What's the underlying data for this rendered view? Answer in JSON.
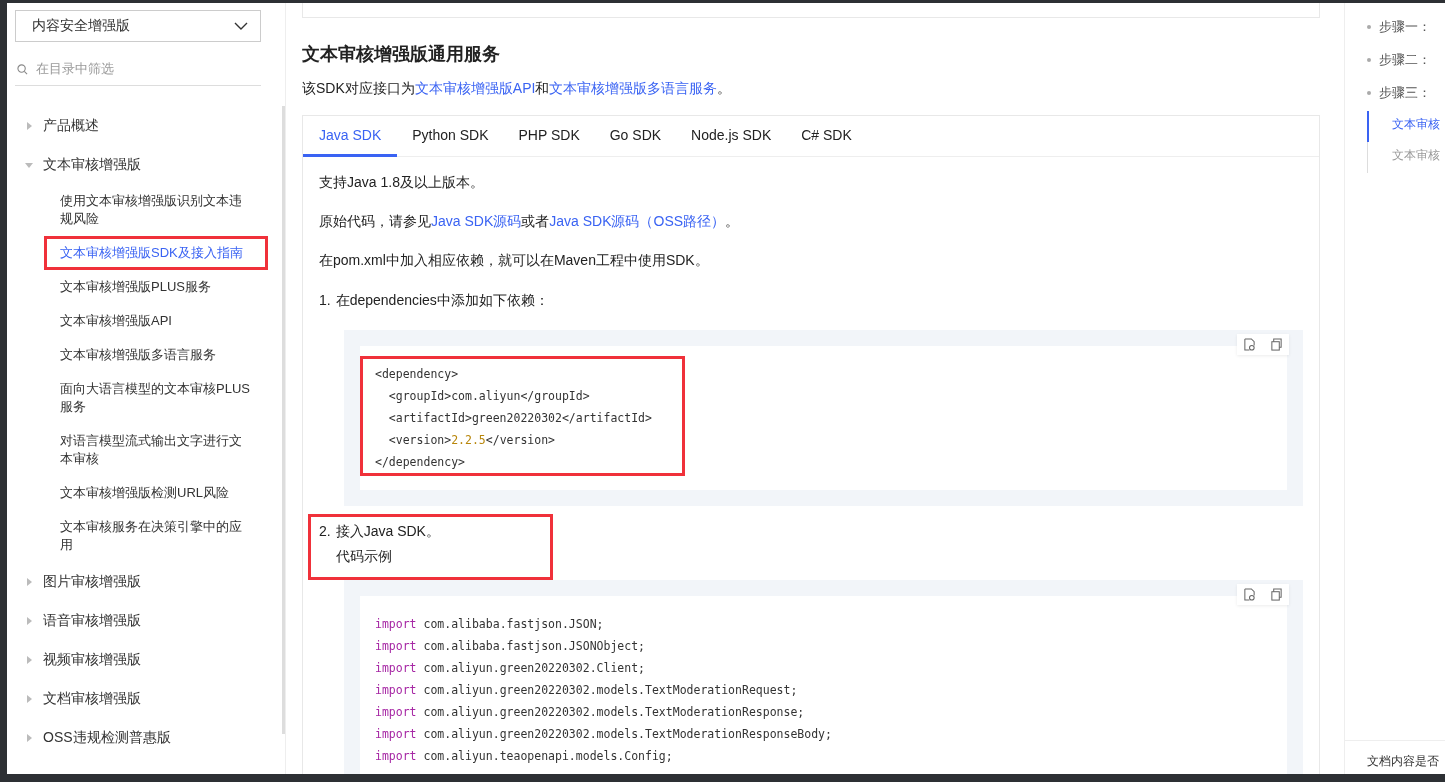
{
  "sidebar": {
    "product_select": "内容安全增强版",
    "filter": {
      "placeholder": "在目录中筛选"
    },
    "tree": [
      {
        "label": "产品概述",
        "expanded": false
      },
      {
        "label": "文本审核增强版",
        "expanded": true,
        "children": [
          {
            "label": "使用文本审核增强版识别文本违规风险",
            "selected": false,
            "highlighted": false
          },
          {
            "label": "文本审核增强版SDK及接入指南",
            "selected": true,
            "highlighted": true
          },
          {
            "label": "文本审核增强版PLUS服务",
            "selected": false,
            "highlighted": false
          },
          {
            "label": "文本审核增强版API",
            "selected": false,
            "highlighted": false
          },
          {
            "label": "文本审核增强版多语言服务",
            "selected": false,
            "highlighted": false
          },
          {
            "label": "面向大语言模型的文本审核PLUS服务",
            "selected": false,
            "highlighted": false
          },
          {
            "label": "对语言模型流式输出文字进行文本审核",
            "selected": false,
            "highlighted": false
          },
          {
            "label": "文本审核增强版检测URL风险",
            "selected": false,
            "highlighted": false
          },
          {
            "label": "文本审核服务在决策引擎中的应用",
            "selected": false,
            "highlighted": false
          }
        ]
      },
      {
        "label": "图片审核增强版",
        "expanded": false
      },
      {
        "label": "语音审核增强版",
        "expanded": false
      },
      {
        "label": "视频审核增强版",
        "expanded": false
      },
      {
        "label": "文档审核增强版",
        "expanded": false
      },
      {
        "label": "OSS违规检测普惠版",
        "expanded": false
      }
    ]
  },
  "main": {
    "heading": "文本审核增强版通用服务",
    "intro": [
      {
        "text": "该SDK对应接口为",
        "kind": "plain"
      },
      {
        "text": "文本审核增强版API",
        "kind": "link"
      },
      {
        "text": "和",
        "kind": "plain"
      },
      {
        "text": "文本审核增强版多语言服务",
        "kind": "link"
      },
      {
        "text": "。",
        "kind": "plain"
      }
    ],
    "tabs": [
      {
        "label": "Java SDK",
        "selected": true
      },
      {
        "label": "Python SDK",
        "selected": false
      },
      {
        "label": "PHP SDK",
        "selected": false
      },
      {
        "label": "Go SDK",
        "selected": false
      },
      {
        "label": "Node.js SDK",
        "selected": false
      },
      {
        "label": "C# SDK",
        "selected": false
      }
    ],
    "paragraphs": [
      [
        {
          "text": "支持Java 1.8及以上版本。",
          "kind": "plain"
        }
      ],
      [
        {
          "text": "原始代码，请参见",
          "kind": "plain"
        },
        {
          "text": "Java SDK源码",
          "kind": "link"
        },
        {
          "text": "或者",
          "kind": "plain"
        },
        {
          "text": "Java SDK源码（OSS路径）",
          "kind": "link"
        },
        {
          "text": "。",
          "kind": "plain"
        }
      ],
      [
        {
          "text": "在pom.xml中加入相应依赖，就可以在Maven工程中使用SDK。",
          "kind": "plain"
        }
      ]
    ],
    "steps": [
      {
        "number": "1.",
        "lines": [
          "在dependencies中添加如下依赖："
        ],
        "highlighted": false,
        "code": {
          "highlighted": true,
          "lines": [
            [
              {
                "text": "<dependency>",
                "kind": "plain"
              }
            ],
            [
              {
                "text": "  <groupId>com.aliyun</groupId>",
                "kind": "plain"
              }
            ],
            [
              {
                "text": "  <artifactId>green20220302</artifactId>",
                "kind": "plain"
              }
            ],
            [
              {
                "text": "  <version>",
                "kind": "plain"
              },
              {
                "text": "2.2.5",
                "kind": "number"
              },
              {
                "text": "</version>",
                "kind": "plain"
              }
            ],
            [
              {
                "text": "</dependency>",
                "kind": "plain"
              }
            ]
          ]
        }
      },
      {
        "number": "2.",
        "lines": [
          "接入Java SDK。",
          "代码示例"
        ],
        "highlighted": true,
        "code": {
          "highlighted": false,
          "lines": [
            [
              {
                "text": "import",
                "kind": "keyword"
              },
              {
                "text": " com.alibaba.fastjson.JSON;",
                "kind": "plain"
              }
            ],
            [
              {
                "text": "import",
                "kind": "keyword"
              },
              {
                "text": " com.alibaba.fastjson.JSONObject;",
                "kind": "plain"
              }
            ],
            [
              {
                "text": "import",
                "kind": "keyword"
              },
              {
                "text": " com.aliyun.green20220302.Client;",
                "kind": "plain"
              }
            ],
            [
              {
                "text": "import",
                "kind": "keyword"
              },
              {
                "text": " com.aliyun.green20220302.models.TextModerationRequest;",
                "kind": "plain"
              }
            ],
            [
              {
                "text": "import",
                "kind": "keyword"
              },
              {
                "text": " com.aliyun.green20220302.models.TextModerationResponse;",
                "kind": "plain"
              }
            ],
            [
              {
                "text": "import",
                "kind": "keyword"
              },
              {
                "text": " com.aliyun.green20220302.models.TextModerationResponseBody;",
                "kind": "plain"
              }
            ],
            [
              {
                "text": "import",
                "kind": "keyword"
              },
              {
                "text": " com.aliyun.teaopenapi.models.Config;",
                "kind": "plain"
              }
            ]
          ]
        }
      }
    ]
  },
  "toc": {
    "items": [
      {
        "label": "步骤一："
      },
      {
        "label": "步骤二："
      },
      {
        "label": "步骤三："
      }
    ],
    "subitems": [
      {
        "label": "文本审核",
        "selected": true
      },
      {
        "label": "文本审核",
        "selected": false
      }
    ],
    "feedback": "文档内容是否"
  }
}
